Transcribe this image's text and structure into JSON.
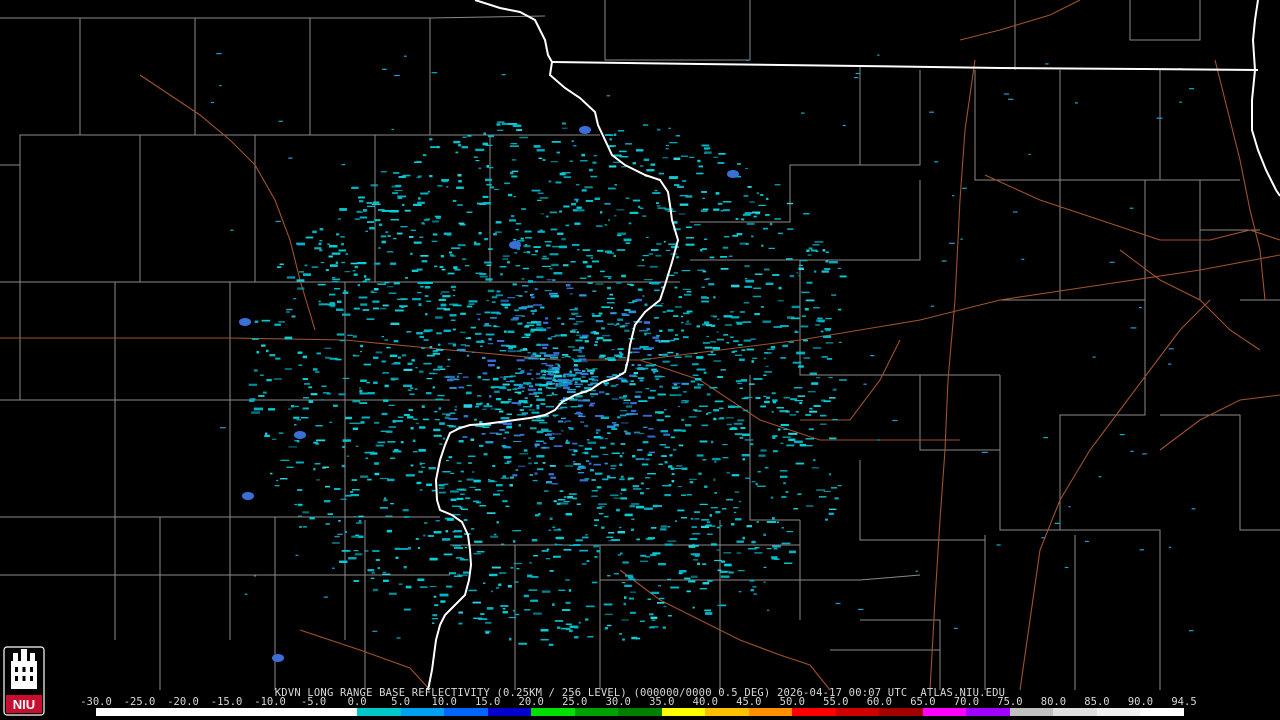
{
  "header": {
    "caption": "KDVN LONG RANGE BASE REFLECTIVITY (0.25KM / 256 LEVEL) (000000/0000 0.5 DEG) 2026-04-17 00:07 UTC  ATLAS.NIU.EDU"
  },
  "logo": {
    "text": "NIU",
    "icon": "niu-castle-logo",
    "color_red": "#c8102e"
  },
  "radar": {
    "site": "KDVN",
    "product": "LONG RANGE BASE REFLECTIVITY",
    "resolution": "0.25KM / 256 LEVEL",
    "elevation": "0.5 DEG",
    "datetime": "2026-04-17 00:07 UTC",
    "source": "ATLAS.NIU.EDU"
  },
  "colorbar": {
    "ticks": [
      "-30.0",
      "-25.0",
      "-20.0",
      "-15.0",
      "-10.0",
      "-5.0",
      "0.0",
      "5.0",
      "10.0",
      "15.0",
      "20.0",
      "25.0",
      "30.0",
      "35.0",
      "40.0",
      "45.0",
      "50.0",
      "55.0",
      "60.0",
      "65.0",
      "70.0",
      "75.0",
      "80.0",
      "85.0",
      "90.0",
      "94.5"
    ],
    "colors": [
      "#ffffff",
      "#ffffff",
      "#ffffff",
      "#ffffff",
      "#ffffff",
      "#ffffff",
      "#00c8c8",
      "#00a0f0",
      "#0064ff",
      "#0000cd",
      "#00e000",
      "#00a000",
      "#008000",
      "#ffff00",
      "#ffc000",
      "#ff9000",
      "#ff0000",
      "#d00000",
      "#a00000",
      "#ff00ff",
      "#a000ff",
      "#c0c0c0",
      "#e0e0e0",
      "#f0f0f0",
      "#ffffff"
    ]
  },
  "map": {
    "state_border_color": "#ffffff",
    "county_line_color": "#8a8a8a",
    "road_color": "#a0522d",
    "echo_colors": [
      "#00b4c8",
      "#00d0d8",
      "#2a9ad8",
      "#3a6fd8",
      "#2bd5e0"
    ]
  }
}
